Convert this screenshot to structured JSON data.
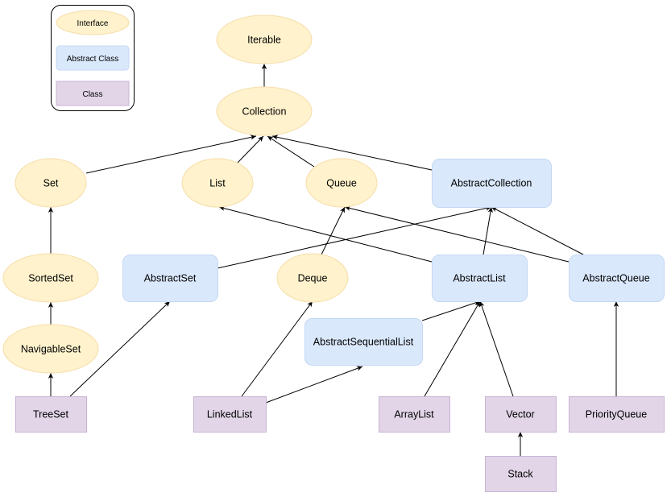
{
  "legend": {
    "interface": "Interface",
    "abstract_class": "Abstract Class",
    "class": "Class"
  },
  "colors": {
    "interface_fill": "#fff2cc",
    "interface_stroke": "#f5deaa",
    "abstract_fill": "#dae8fc",
    "abstract_stroke": "#c4d8f2",
    "class_fill": "#e1d5e7",
    "class_stroke": "#c9b3d4",
    "edge": "#000000"
  },
  "nodes": [
    {
      "id": "Iterable",
      "label": "Iterable",
      "kind": "interface"
    },
    {
      "id": "Collection",
      "label": "Collection",
      "kind": "interface"
    },
    {
      "id": "Set",
      "label": "Set",
      "kind": "interface"
    },
    {
      "id": "List",
      "label": "List",
      "kind": "interface"
    },
    {
      "id": "Queue",
      "label": "Queue",
      "kind": "interface"
    },
    {
      "id": "AbstractCollection",
      "label": "AbstractCollection",
      "kind": "abstract"
    },
    {
      "id": "SortedSet",
      "label": "SortedSet",
      "kind": "interface"
    },
    {
      "id": "NavigableSet",
      "label": "NavigableSet",
      "kind": "interface"
    },
    {
      "id": "AbstractSet",
      "label": "AbstractSet",
      "kind": "abstract"
    },
    {
      "id": "Deque",
      "label": "Deque",
      "kind": "interface"
    },
    {
      "id": "AbstractList",
      "label": "AbstractList",
      "kind": "abstract"
    },
    {
      "id": "AbstractQueue",
      "label": "AbstractQueue",
      "kind": "abstract"
    },
    {
      "id": "AbstractSequentialList",
      "label": "AbstractSequentialList",
      "kind": "abstract"
    },
    {
      "id": "TreeSet",
      "label": "TreeSet",
      "kind": "class"
    },
    {
      "id": "LinkedList",
      "label": "LinkedList",
      "kind": "class"
    },
    {
      "id": "ArrayList",
      "label": "ArrayList",
      "kind": "class"
    },
    {
      "id": "Vector",
      "label": "Vector",
      "kind": "class"
    },
    {
      "id": "PriorityQueue",
      "label": "PriorityQueue",
      "kind": "class"
    },
    {
      "id": "Stack",
      "label": "Stack",
      "kind": "class"
    }
  ],
  "edges": [
    {
      "from": "Collection",
      "to": "Iterable"
    },
    {
      "from": "Set",
      "to": "Collection"
    },
    {
      "from": "List",
      "to": "Collection"
    },
    {
      "from": "Queue",
      "to": "Collection"
    },
    {
      "from": "AbstractCollection",
      "to": "Collection"
    },
    {
      "from": "SortedSet",
      "to": "Set"
    },
    {
      "from": "NavigableSet",
      "to": "SortedSet"
    },
    {
      "from": "TreeSet",
      "to": "NavigableSet"
    },
    {
      "from": "TreeSet",
      "to": "AbstractSet"
    },
    {
      "from": "AbstractSet",
      "to": "AbstractCollection"
    },
    {
      "from": "Deque",
      "to": "Queue"
    },
    {
      "from": "AbstractList",
      "to": "List"
    },
    {
      "from": "AbstractList",
      "to": "AbstractCollection"
    },
    {
      "from": "AbstractQueue",
      "to": "Queue"
    },
    {
      "from": "AbstractQueue",
      "to": "AbstractCollection"
    },
    {
      "from": "LinkedList",
      "to": "Deque"
    },
    {
      "from": "LinkedList",
      "to": "AbstractSequentialList"
    },
    {
      "from": "AbstractSequentialList",
      "to": "AbstractList"
    },
    {
      "from": "ArrayList",
      "to": "AbstractList"
    },
    {
      "from": "Vector",
      "to": "AbstractList"
    },
    {
      "from": "Stack",
      "to": "Vector"
    },
    {
      "from": "PriorityQueue",
      "to": "AbstractQueue"
    }
  ]
}
